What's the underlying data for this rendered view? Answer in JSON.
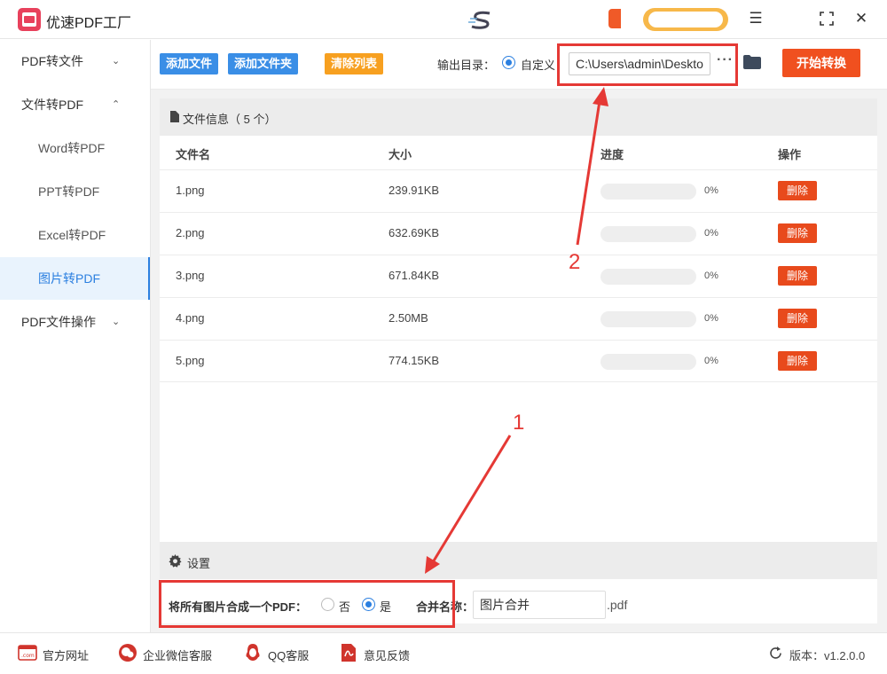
{
  "app": {
    "title": "优速PDF工厂"
  },
  "sidebar": {
    "items": [
      {
        "label": "PDF转文件",
        "type": "top",
        "chevron": "down"
      },
      {
        "label": "文件转PDF",
        "type": "top",
        "chevron": "up"
      },
      {
        "label": "Word转PDF",
        "type": "sub"
      },
      {
        "label": "PPT转PDF",
        "type": "sub"
      },
      {
        "label": "Excel转PDF",
        "type": "sub"
      },
      {
        "label": "图片转PDF",
        "type": "sub",
        "active": true
      },
      {
        "label": "PDF文件操作",
        "type": "top",
        "chevron": "down"
      }
    ]
  },
  "toolbar": {
    "add_file": "添加文件",
    "add_folder": "添加文件夹",
    "clear_list": "清除列表",
    "output_label": "输出目录：",
    "custom_label": "自定义",
    "output_path": "C:\\Users\\admin\\Desktop",
    "more": "···",
    "start": "开始转换"
  },
  "file_panel": {
    "title": "文件信息（ 5 个）",
    "columns": {
      "name": "文件名",
      "size": "大小",
      "progress": "进度",
      "action": "操作"
    },
    "rows": [
      {
        "name": "1.png",
        "size": "239.91KB",
        "progress": 0,
        "progress_text": "0%",
        "action": "删除"
      },
      {
        "name": "2.png",
        "size": "632.69KB",
        "progress": 0,
        "progress_text": "0%",
        "action": "删除"
      },
      {
        "name": "3.png",
        "size": "671.84KB",
        "progress": 0,
        "progress_text": "0%",
        "action": "删除"
      },
      {
        "name": "4.png",
        "size": "2.50MB",
        "progress": 0,
        "progress_text": "0%",
        "action": "删除"
      },
      {
        "name": "5.png",
        "size": "774.15KB",
        "progress": 0,
        "progress_text": "0%",
        "action": "删除"
      }
    ]
  },
  "settings": {
    "title": "设置",
    "merge_label": "将所有图片合成一个PDF：",
    "no_label": "否",
    "yes_label": "是",
    "merge_selected": "是",
    "name_label": "合并名称：",
    "name_value": "图片合并",
    "ext": ".pdf"
  },
  "footer": {
    "website": "官方网址",
    "wechat": "企业微信客服",
    "qq": "QQ客服",
    "feedback": "意见反馈",
    "version": "版本：v1.2.0.0"
  },
  "annotations": {
    "one": "1",
    "two": "2"
  },
  "colors": {
    "accent": "#2b7fe0",
    "start": "#f0501f",
    "delete": "#e84a1c",
    "annotation": "#e53935"
  }
}
